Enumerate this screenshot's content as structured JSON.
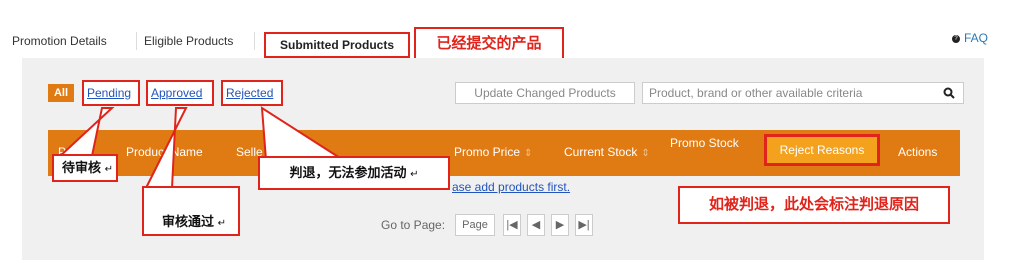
{
  "tabs": {
    "items": [
      {
        "label": "Promotion Details"
      },
      {
        "label": "Eligible Products"
      },
      {
        "label": "Submitted Products"
      }
    ],
    "callout": "已经提交的产品",
    "faq_label": "FAQ"
  },
  "filters": {
    "all": "All",
    "pending": "Pending",
    "approved": "Approved",
    "rejected": "Rejected"
  },
  "toolbar": {
    "update_button": "Update Changed Products",
    "search_placeholder": "Product, brand or other available criteria"
  },
  "table": {
    "headers": {
      "col1": "P",
      "product_name": "Product Name",
      "seller": "Selle",
      "promo_price": "Promo Price",
      "current_stock": "Current Stock",
      "promo_stock": "Promo Stock",
      "reject_reasons": "Reject Reasons",
      "actions": "Actions"
    },
    "empty_link": "ase add products first."
  },
  "pager": {
    "label": "Go to Page:",
    "page_input": "Page",
    "first": "|◀",
    "prev": "◀",
    "next": "▶",
    "last": "▶|"
  },
  "annotations": {
    "pending": "待审核",
    "approved": "审核通过",
    "rejected": "判退，无法参加活动",
    "reject_reason": "如被判退，此处会标注判退原因",
    "mark": "↵"
  },
  "colors": {
    "accent_orange": "#e07b13",
    "callout_red": "#e0241b",
    "link_blue": "#2255bb"
  }
}
